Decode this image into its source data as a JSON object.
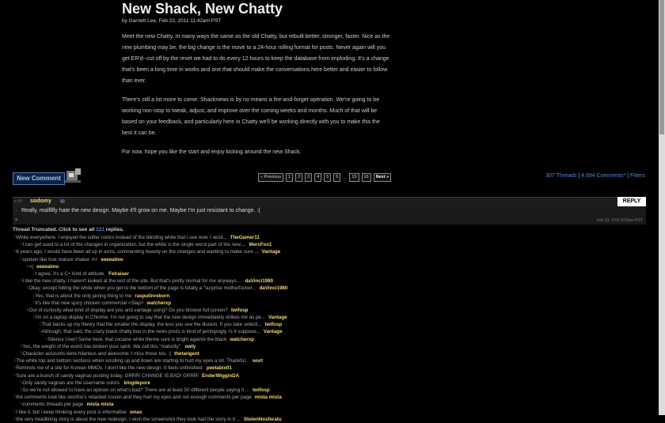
{
  "article": {
    "title": "New Shack, New Chatty",
    "byline": "by Garnett Lee, Feb 23, 2011 11:42am PST",
    "paragraphs": [
      "Meet the new Chatty. In many ways the same as the old Chatty, but rebuilt better, stronger, faster. Nice as the new plumbing may be, the big change is the move to a 24-hour rolling format for posts. Never again will you get ER'd--cut off by the reset we had to do every 12 hours to keep the database from imploding. It's a change that's been a long time in works and one that should make the conversations here better and easier to follow than ever.",
      "There's still a lot more to come. Shacknews is by no means a fire-and-forget operation. We're going to be working non-stop to tweak, adjust, and improve over the coming weeks and months. Much of that will be based on your feedback, and particularly here in Chatty we'll be working directly with you to make this the best it can be.",
      "For now, hope you like the start and enjoy kicking around the new Shack."
    ]
  },
  "new_comment_label": "New Comment",
  "pager": {
    "previous": "« Previous",
    "pages": [
      "1",
      "2",
      "3",
      "4",
      "5",
      "6"
    ],
    "ellipsis": "...",
    "last_pages": [
      "15",
      "16"
    ],
    "next": "Next »"
  },
  "thread_stats": {
    "threads": "307 Threads",
    "comments": "4,694 Comments*",
    "filters": "Filters",
    "sep": "|"
  },
  "root": {
    "arrow": "«",
    "in": "in",
    "user": "sodomy",
    "reply_label": "REPLY",
    "text": "Really, realllllly hate the new design. Maybe it'll grow on me. Maybe I'm just resistant to change. :(",
    "date": "Feb 23, 2011 8:53pm PST"
  },
  "truncated": {
    "before": "Thread Truncated. Click to see all",
    "count": "121",
    "after": "replies."
  },
  "replies": [
    {
      "indent": 0,
      "text": "White everywhere. I enjoyed the softer colors instead of the blinding white that i see now. I woul...",
      "author": "TheGamer11"
    },
    {
      "indent": 1,
      "text": "I can get used to a lot of the changes in organization, but the white is the single worst part of the new....",
      "author": "MercFox1"
    },
    {
      "indent": 0,
      "text": "6 years ago, I would have been all up in arms, commenting heavily on the changes and wanting to make sure ...",
      "author": "Vantage"
    },
    {
      "indent": 1,
      "text": "spoken like true mature shaker. A+",
      "author": "eeeealmo"
    },
    {
      "indent": 2,
      "text": "+(",
      "author": "eeeealmo"
    },
    {
      "indent": 3,
      "text": "I agree, it's a C+ kind of attitude.",
      "author": "Felraiser"
    },
    {
      "indent": 1,
      "text": "I like the new chatty. I haven't looked at the rest of the site. But that's pretty normal for me anyways....",
      "author": "daVinci1980"
    },
    {
      "indent": 2,
      "text": "Okay, except hitting the white when you get to the bottom of the page is totally a \"surprise motherfucker...",
      "author": "daVinci1980"
    },
    {
      "indent": 3,
      "text": "Yes, that is about the only jarring thing to me",
      "author": "rasputinreborn"
    },
    {
      "indent": 3,
      "text": "It's like that new spicy chicken commercial <Slap>",
      "author": "watcherxp"
    },
    {
      "indent": 2,
      "text": "Out of curiosity what kind of display are you and vantage using? Do you browse full screen?",
      "author": "twifosp"
    },
    {
      "indent": 3,
      "text": "I'm on a laptop display in Chrome. I'm not going to say that the new design immediately strikes me as pe...",
      "author": "Vantage"
    },
    {
      "indent": 4,
      "text": "That backs up my theory that the smaller the display, the less you see the illusion. If you take selecti...",
      "author": "twifosp"
    },
    {
      "indent": 4,
      "text": "Although, that said, the crazy black chatty box in the news posts is kind of jarring/ugly. Is it suppose...",
      "author": "Vantage"
    },
    {
      "indent": 5,
      "text": "Silence User! Same here, that cocaine white theme sure is bright against the black",
      "author": "watcherxp"
    },
    {
      "indent": 1,
      "text": "Yes, the weight of the world has broken your spirit. We call this \"maturity\".",
      "author": "owly"
    },
    {
      "indent": 1,
      "text": "Character accounts were hilarious and awesome. I miss those too. :(",
      "author": "thetangent"
    },
    {
      "indent": 0,
      "text": "The white top and bottom sections when scrolling up and down are starting to hurt my eyes a lot. Thankful...",
      "author": "wurt"
    },
    {
      "indent": 0,
      "text": "Reminds me of a site for Korean MMOs. I don't like the new design. It feels unfinished.",
      "author": "peetabix01"
    },
    {
      "indent": 0,
      "text": "Sure are a bunch of sandy vaginas posting today. GRRR! CHANGE IS BAD! GRRR!",
      "author": "EnderWigginDA"
    },
    {
      "indent": 1,
      "text": "Only sandy vaginas are the username colors.",
      "author": "kingdeporк"
    },
    {
      "indent": 1,
      "text": "So we're not allowed to have an opinion on what's bad? There are at least 50 different people saying it ...",
      "author": "twifosp"
    },
    {
      "indent": 0,
      "text": "the comments look like stoofoo's retarded cousin and they hurt my eyes and not enough comments per page",
      "author": "mista mista"
    },
    {
      "indent": 1,
      "text": "comments threads per page",
      "author": "mista mista"
    },
    {
      "indent": 0,
      "text": "I like it, but i keep thinking every post is informative",
      "author": "smax"
    },
    {
      "indent": 0,
      "text": "the very headlining story is about the new redesign. I wish the screenshot they took had the story in it ...",
      "author": "StolenNosferatu"
    }
  ]
}
